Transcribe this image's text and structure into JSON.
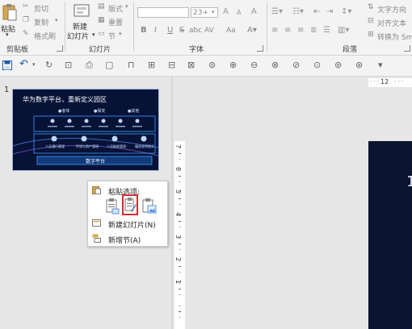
{
  "ribbon": {
    "clipboard": {
      "paste": "粘贴",
      "cut": "剪切",
      "copy": "复制",
      "format_painter": "格式刷",
      "group_label": "剪贴板"
    },
    "slides": {
      "new_slide_1": "新建",
      "new_slide_2": "幻灯片",
      "layout": "版式",
      "reset": "重置",
      "section": "节",
      "group_label": "幻灯片"
    },
    "font": {
      "size_value": "23+",
      "group_label": "字体",
      "bold": "B",
      "italic": "I",
      "underline": "U",
      "strike": "S",
      "shadow": "abc",
      "spacing": "AV",
      "case": "Aa",
      "clear": "A",
      "grow": "A",
      "shrink": "A"
    },
    "paragraph": {
      "text_direction": "文字方向",
      "align_text": "对齐文本",
      "convert": "转换为 Sm",
      "group_label": "段落"
    }
  },
  "ruler": {
    "h_label": "12",
    "v_numbers": [
      "7",
      "6",
      "5",
      "4",
      "3",
      "2",
      "1"
    ]
  },
  "slide_panel": {
    "slide_number": "1",
    "thumbnail": {
      "title": "华为数字平台，重新定义园区",
      "top_labels": [
        "●客体",
        "●保安",
        "●其他"
      ],
      "footer": "数字平台",
      "row_labels": [
        "人员通行管理",
        "环境与资产管理",
        "人员能耗管理",
        "服务效率提升"
      ]
    }
  },
  "editor": {
    "slide_glyph": "1"
  },
  "context_menu": {
    "paste_options": "粘贴选项:",
    "new_slide": "新建幻灯片(N)",
    "new_section": "新增节(A)"
  }
}
